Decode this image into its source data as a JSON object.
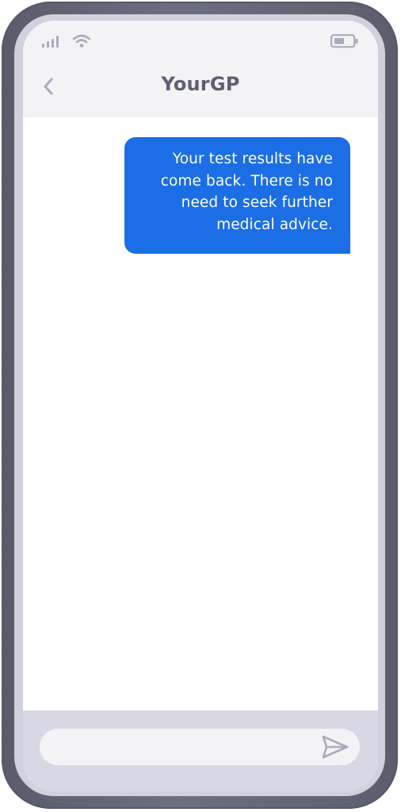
{
  "header": {
    "title": "YourGP",
    "back_icon": "chevron-left-icon"
  },
  "status_bar": {
    "icons": [
      "signal-icon",
      "wifi-icon",
      "battery-icon"
    ]
  },
  "messages": [
    {
      "direction": "outgoing",
      "text": "Your test results have come back. There is no need to seek further medical advice."
    }
  ],
  "composer": {
    "placeholder": "",
    "value": "",
    "send_icon": "send-icon"
  },
  "colors": {
    "frame": "#656878",
    "bubble": "#1b6ee6",
    "header_bg": "#f3f3f6",
    "title": "#5e6070",
    "composer_bar": "#d7d8e3",
    "icons": "#a9abb8"
  }
}
